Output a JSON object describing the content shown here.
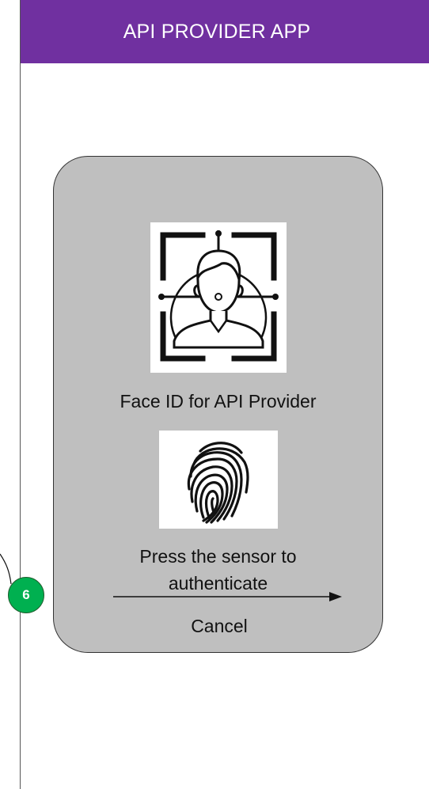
{
  "header": {
    "title": "API PROVIDER APP"
  },
  "dialog": {
    "face_id_icon": "face-scan-icon",
    "face_caption": "Face ID for API Provider",
    "fingerprint_icon": "fingerprint-icon",
    "prompt_line1": "Press the sensor to",
    "prompt_line2": "authenticate",
    "cancel_label": "Cancel"
  },
  "step_badge": {
    "number": "6"
  },
  "colors": {
    "header_bg": "#7030a0",
    "card_bg": "#bfbfbf",
    "badge_bg": "#00b050"
  }
}
